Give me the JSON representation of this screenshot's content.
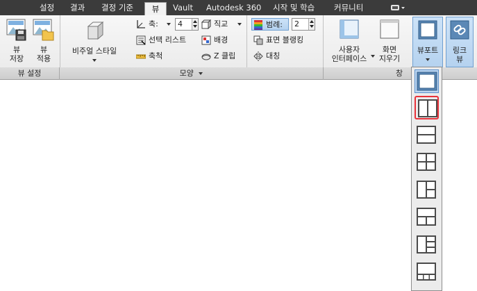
{
  "tabs": [
    {
      "label": "설정"
    },
    {
      "label": "결과"
    },
    {
      "label": "결정 기준"
    },
    {
      "label": "뷰",
      "active": true
    },
    {
      "label": "Vault"
    },
    {
      "label": "Autodesk 360"
    },
    {
      "label": "시작 및 학습"
    },
    {
      "label": "커뮤니티"
    }
  ],
  "groups": {
    "view_settings": {
      "label": "뷰 설정",
      "save_view": {
        "line1": "뷰",
        "line2": "저장"
      },
      "apply_view": {
        "line1": "뷰",
        "line2": "적용"
      }
    },
    "appearance": {
      "label": "모양",
      "visual_style": {
        "label": "비주얼 스타일"
      },
      "axis": {
        "label": "축:",
        "value": "4"
      },
      "ortho": {
        "label": "직교"
      },
      "select_list": {
        "label": "선택 리스트"
      },
      "background": {
        "label": "배경"
      },
      "ruler": {
        "label": "축척"
      },
      "z_clip": {
        "label": "Z 클립"
      },
      "legend": {
        "label": "범례:",
        "value": "2"
      },
      "surface_blanking": {
        "label": "표면 블랭킹"
      },
      "symmetry": {
        "label": "대칭"
      }
    },
    "window": {
      "label": "창",
      "user_interface": {
        "line1": "사용자",
        "line2": "인터페이스"
      },
      "clear_screen": {
        "line1": "화면",
        "line2": "지우기"
      },
      "viewport": {
        "label": "뷰포트"
      },
      "link_view": {
        "line1": "링크",
        "line2": "뷰"
      }
    }
  },
  "viewport_dropdown": {
    "options": [
      {
        "name": "single"
      },
      {
        "name": "two-vertical"
      },
      {
        "name": "two-horizontal"
      },
      {
        "name": "four-grid"
      },
      {
        "name": "three-left-large"
      },
      {
        "name": "three-top-large"
      },
      {
        "name": "four-left-large"
      },
      {
        "name": "four-bottom-small"
      }
    ]
  },
  "colors": {
    "tabbar": "#3b3b3b",
    "highlight": "#e8323a",
    "selected": "#bcd6f1"
  }
}
